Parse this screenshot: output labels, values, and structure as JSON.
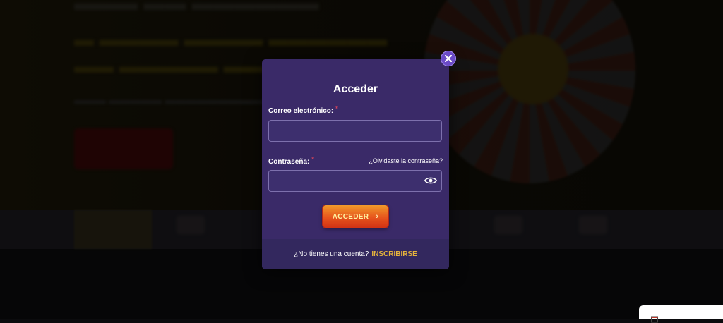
{
  "modal": {
    "title": "Acceder",
    "email": {
      "label": "Correo electrónico:",
      "required_mark": "*",
      "value": "",
      "placeholder": ""
    },
    "password": {
      "label": "Contraseña:",
      "required_mark": "*",
      "value": "",
      "placeholder": ""
    },
    "forgot_link": "¿Olvidaste la contraseña?",
    "submit_label": "ACCEDER",
    "submit_chevron": "›",
    "footer": {
      "text": "¿No tienes una cuenta?",
      "signup_link": "INSCRIBIRSE"
    }
  },
  "icons": {
    "close": "close-icon",
    "password_toggle": "eye-icon",
    "submit": "chevron-right-icon"
  },
  "colors": {
    "modal_bg": "#3a2a68",
    "footer_bg": "#33285e",
    "accent_button": "#e7541d",
    "link_yellow": "#e6b43c",
    "close_purple": "#6b4bc7"
  }
}
